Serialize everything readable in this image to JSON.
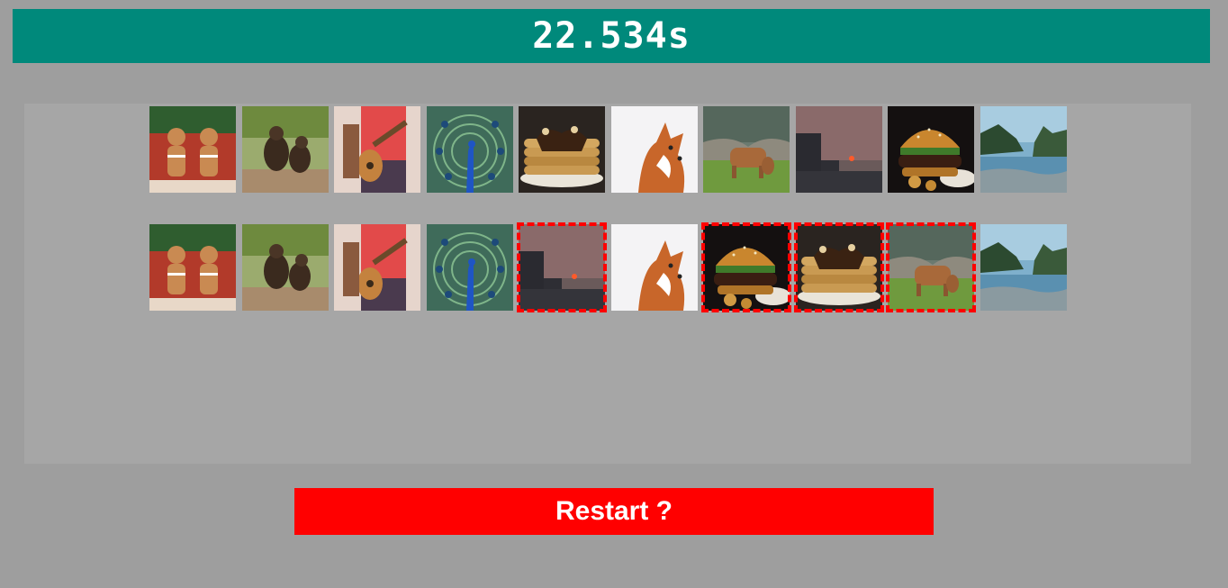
{
  "timer": {
    "text": "22.534s"
  },
  "restart": {
    "label": "Restart ?"
  },
  "reference_row": [
    {
      "image": "gingerbread-men"
    },
    {
      "image": "monkeys"
    },
    {
      "image": "guitar-player"
    },
    {
      "image": "peacock"
    },
    {
      "image": "pancakes"
    },
    {
      "image": "fox"
    },
    {
      "image": "cow"
    },
    {
      "image": "sunset"
    },
    {
      "image": "burger"
    },
    {
      "image": "coastline"
    }
  ],
  "player_row": [
    {
      "image": "gingerbread-men",
      "wrong": false
    },
    {
      "image": "monkeys",
      "wrong": false
    },
    {
      "image": "guitar-player",
      "wrong": false
    },
    {
      "image": "peacock",
      "wrong": false
    },
    {
      "image": "sunset",
      "wrong": true
    },
    {
      "image": "fox",
      "wrong": false
    },
    {
      "image": "burger",
      "wrong": true
    },
    {
      "image": "pancakes",
      "wrong": true
    },
    {
      "image": "cow",
      "wrong": true
    },
    {
      "image": "coastline",
      "wrong": false
    }
  ],
  "colors": {
    "header": "#00897b",
    "restart": "#ff0000",
    "wrong_outline": "#ff0000",
    "board": "#a6a6a6",
    "page": "#9e9e9e"
  }
}
